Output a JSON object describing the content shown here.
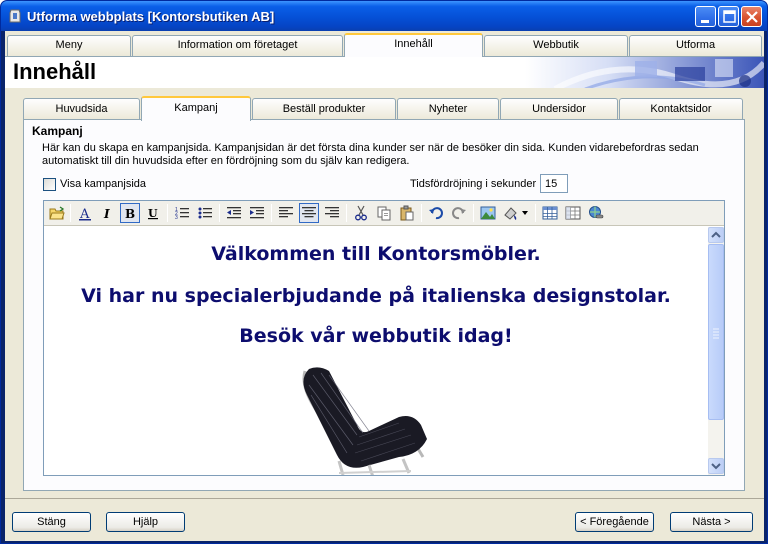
{
  "window": {
    "title": "Utforma webbplats [Kontorsbutiken AB]",
    "buttons": [
      "minimize",
      "maximize",
      "close"
    ]
  },
  "main_tabs": [
    {
      "label": "Meny"
    },
    {
      "label": "Information om företaget"
    },
    {
      "label": "Innehåll"
    },
    {
      "label": "Webbutik"
    },
    {
      "label": "Utforma"
    }
  ],
  "main_tabs_active": "Innehåll",
  "header": {
    "title": "Innehåll"
  },
  "sub_tabs": [
    {
      "label": "Huvudsida"
    },
    {
      "label": "Kampanj"
    },
    {
      "label": "Beställ produkter"
    },
    {
      "label": "Nyheter"
    },
    {
      "label": "Undersidor"
    },
    {
      "label": "Kontaktsidor"
    }
  ],
  "sub_tabs_active": "Kampanj",
  "campaign": {
    "title": "Kampanj",
    "description": "Här kan du skapa en kampanjsida. Kampanjsidan är det första dina kunder ser när de besöker din sida. Kunden vidarebefordras sedan automatiskt till din huvudsida efter en fördröjning som du själv kan redigera.",
    "show_checkbox_label": "Visa kampanjsida",
    "show_checkbox_checked": false,
    "delay_label": "Tidsfördröjning i sekunder",
    "delay_value": "15"
  },
  "editor": {
    "toolbar_icons": [
      "open-icon",
      "font-icon",
      "italic-icon",
      "bold-icon",
      "underline-icon",
      "numbered-list-icon",
      "bullet-list-icon",
      "outdent-icon",
      "indent-icon",
      "align-left-icon",
      "align-center-icon",
      "align-right-icon",
      "cut-icon",
      "copy-icon",
      "paste-icon",
      "undo-icon",
      "redo-icon",
      "insert-image-icon",
      "color-icon",
      "insert-table-icon",
      "table-properties-icon",
      "insert-link-icon"
    ],
    "bold_pressed": true,
    "align_center_pressed": true,
    "content_lines": [
      "Välkommen till Kontorsmöbler.",
      "Vi har nu specialerbjudande på italienska designstolar.",
      "Besök vår webbutik idag!"
    ],
    "text_color": "#0d0d6e"
  },
  "buttons": {
    "close": "Stäng",
    "help": "Hjälp",
    "previous": "< Föregående",
    "next": "Nästa >"
  }
}
